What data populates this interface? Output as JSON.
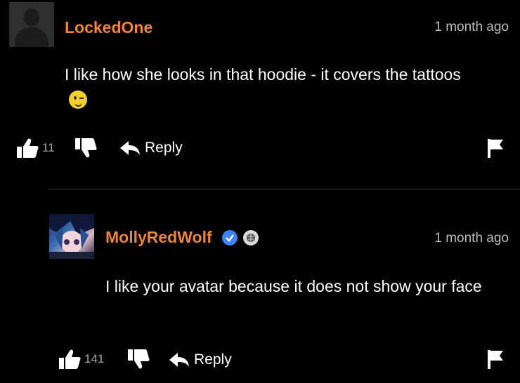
{
  "comment1": {
    "username": "LockedOne",
    "username_color": "#f0843a",
    "timestamp": "1 month ago",
    "text": "I like how she looks in that hoodie - it covers the tattoos",
    "likes": "11",
    "reply_label": "Reply",
    "avatar_icon": "default-user-icon",
    "emoji_icon": "winking-face-icon"
  },
  "comment2": {
    "username": "MollyRedWolf",
    "username_color": "#f0843a",
    "timestamp": "1 month ago",
    "text": "I like your avatar because it does not show your face",
    "likes": "141",
    "reply_label": "Reply",
    "avatar_icon": "anime-avatar",
    "verified_color": "#3b82f6"
  }
}
